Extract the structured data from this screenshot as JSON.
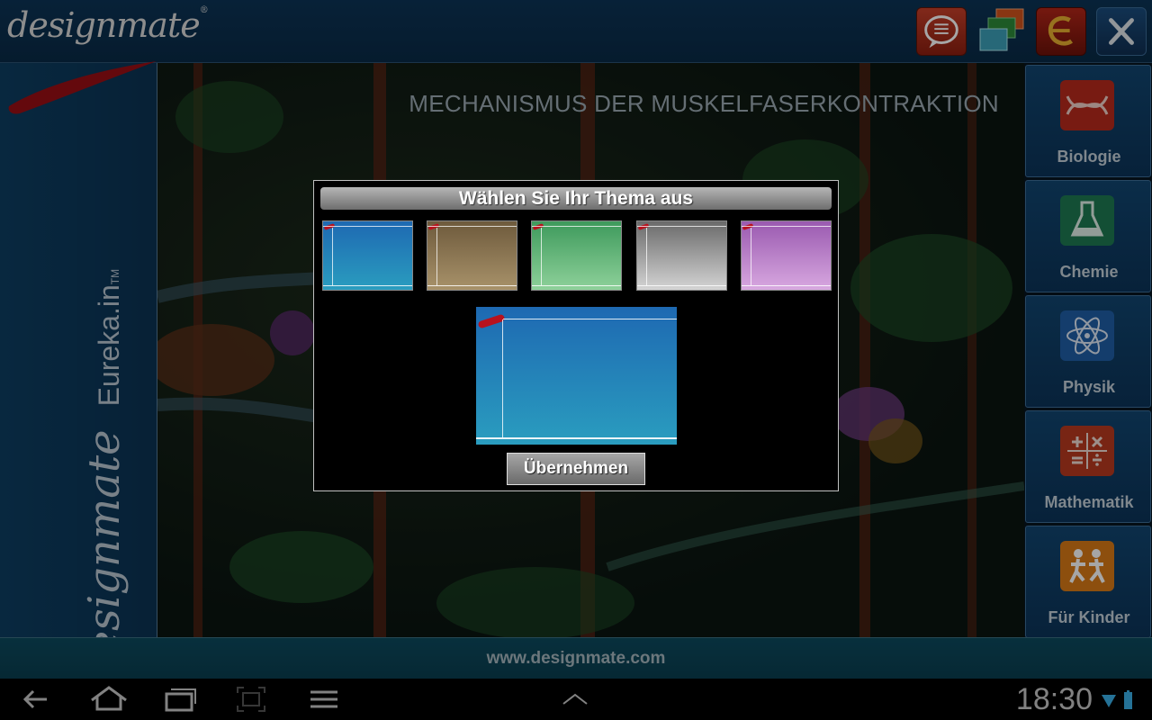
{
  "app": {
    "logo": "designmate",
    "logo_tm": "®",
    "side_brand": "designmate",
    "side_product": "Eureka.in",
    "side_tm": "TM"
  },
  "topbar": {
    "icons": [
      "chat-icon",
      "windows-icon",
      "eureka-icon",
      "close-icon"
    ]
  },
  "scene": {
    "title": "MECHANISMUS DER MUSKELFASERKONTRAKTION"
  },
  "subjects": [
    {
      "label": "Biologie",
      "icon": "dna-icon",
      "color": "#b82a1c"
    },
    {
      "label": "Chemie",
      "icon": "flask-icon",
      "color": "#1e7a52"
    },
    {
      "label": "Physik",
      "icon": "atom-icon",
      "color": "#1f5fa6"
    },
    {
      "label": "Mathematik",
      "icon": "math-icon",
      "color": "#b83a1f"
    },
    {
      "label": "Für Kinder",
      "icon": "kids-icon",
      "color": "#d97a16"
    }
  ],
  "dialog": {
    "title": "Wählen Sie Ihr Thema aus",
    "themes": [
      {
        "name": "blue",
        "color_top": "#1e69b2",
        "color_bottom": "#2a9dbf"
      },
      {
        "name": "brown",
        "color_top": "#6e5a3c",
        "color_bottom": "#a8926a"
      },
      {
        "name": "green",
        "color_top": "#3e9a5c",
        "color_bottom": "#8ed19a"
      },
      {
        "name": "gray",
        "color_top": "#6a6a6a",
        "color_bottom": "#d4d4d4"
      },
      {
        "name": "purple",
        "color_top": "#9a5ab0",
        "color_bottom": "#d8a8e0"
      }
    ],
    "apply_label": "Übernehmen"
  },
  "footer": {
    "url": "www.designmate.com"
  },
  "system": {
    "clock": "18:30"
  }
}
